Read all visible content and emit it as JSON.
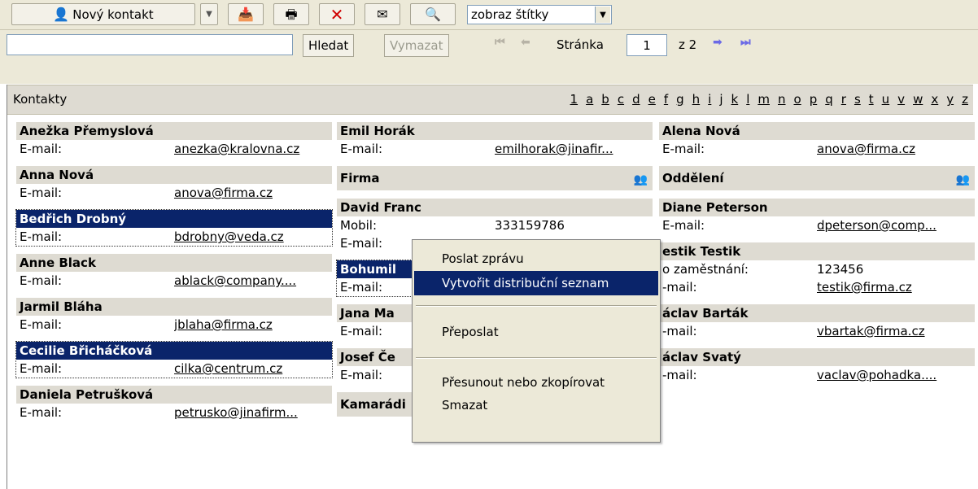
{
  "toolbar": {
    "new_contact_label": "Nový kontakt",
    "labels_select_value": "zobraz štítky"
  },
  "search": {
    "input_value": "",
    "search_label": "Hledat",
    "clear_label": "Vymazat",
    "page_label": "Stránka",
    "page_value": "1",
    "page_total": "z 2"
  },
  "header": {
    "title": "Kontakty",
    "alphabet": [
      "1",
      "a",
      "b",
      "c",
      "d",
      "e",
      "f",
      "g",
      "h",
      "i",
      "j",
      "k",
      "l",
      "m",
      "n",
      "o",
      "p",
      "q",
      "r",
      "s",
      "t",
      "u",
      "v",
      "w",
      "x",
      "y",
      "z"
    ]
  },
  "columns": {
    "c1": [
      {
        "name": "Anežka Přemyslová",
        "rows": [
          {
            "label": "E-mail:",
            "value": "anezka@kralovna.cz"
          }
        ]
      },
      {
        "name": "Anna Nová",
        "rows": [
          {
            "label": "E-mail:",
            "value": "anova@firma.cz"
          }
        ]
      },
      {
        "name": "Bedřich Drobný",
        "rows": [
          {
            "label": "E-mail:",
            "value": "bdrobny@veda.cz"
          }
        ]
      },
      {
        "name": "Anne Black",
        "rows": [
          {
            "label": "E-mail:",
            "value": "ablack@company...."
          }
        ]
      },
      {
        "name": "Jarmil Bláha",
        "rows": [
          {
            "label": "E-mail:",
            "value": "jblaha@firma.cz"
          }
        ]
      },
      {
        "name": "Cecilie Břicháčková",
        "rows": [
          {
            "label": "E-mail:",
            "value": "cilka@centrum.cz"
          }
        ]
      },
      {
        "name": "Daniela Petrušková",
        "rows": [
          {
            "label": "E-mail:",
            "value": "petrusko@jinafirm..."
          }
        ]
      }
    ],
    "c2_top": {
      "name": "Emil Horák",
      "rows": [
        {
          "label": "E-mail:",
          "value": "emilhorak@jinafir..."
        }
      ]
    },
    "c2_group1": "Firma",
    "c2_david": {
      "name": "David Franc",
      "rows": [
        {
          "label": "Mobil:",
          "value": "333159786"
        },
        {
          "label": "E-mail:",
          "value": ""
        }
      ]
    },
    "c2_bohumil": {
      "name": "Bohumil",
      "rows": [
        {
          "label": "E-mail:",
          "value": ""
        }
      ]
    },
    "c2_jana": {
      "name": "Jana Ma",
      "rows": [
        {
          "label": "E-mail:",
          "value": ""
        }
      ]
    },
    "c2_josef": {
      "name": "Josef Če",
      "rows": [
        {
          "label": "E-mail:",
          "value": ""
        }
      ]
    },
    "c2_group2": "Kamarádi",
    "c3_top": {
      "name": "Alena Nová",
      "rows": [
        {
          "label": "E-mail:",
          "value": "anova@firma.cz"
        }
      ]
    },
    "c3_group": "Oddělení",
    "c3_diane": {
      "name": "Diane Peterson",
      "rows": [
        {
          "label": "E-mail:",
          "value": "dpeterson@comp..."
        }
      ]
    },
    "c3_testik": {
      "name": "estik Testik",
      "rows": [
        {
          "label": "o zaměstnání:",
          "value": "123456"
        },
        {
          "label": "-mail:",
          "value": "testik@firma.cz"
        }
      ]
    },
    "c3_vbartak": {
      "name": "áclav Barták",
      "rows": [
        {
          "label": "-mail:",
          "value": "vbartak@firma.cz"
        }
      ]
    },
    "c3_vsvaty": {
      "name": "áclav Svatý",
      "rows": [
        {
          "label": "-mail:",
          "value": "vaclav@pohadka...."
        }
      ]
    }
  },
  "context_menu": {
    "send_message": "Poslat zprávu",
    "create_distribution_list": "Vytvořit distribuční seznam",
    "forward": "Přeposlat",
    "move_or_copy": "Přesunout nebo zkopírovat",
    "delete": "Smazat"
  }
}
